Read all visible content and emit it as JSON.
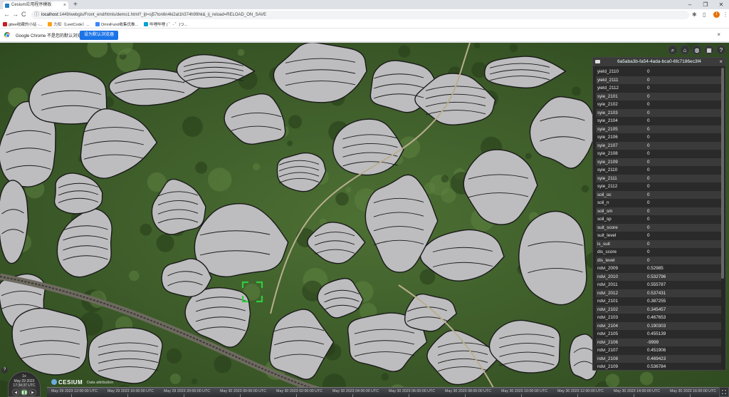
{
  "browser": {
    "tab_title": "Cesium应用程序模板",
    "tab_close": "×",
    "new_tab": "+",
    "window_controls": [
      "–",
      "❐",
      "✕"
    ],
    "url_host": "localhost",
    "url_rest": ":1449/webgis/Front_end/htmls/demo1.html?_ijt=sj57ton6n4ki2at1h374h99hk&_ij_reload=RELOAD_ON_SAVE",
    "nav": [
      "←",
      "→",
      "C",
      "⌂"
    ],
    "bookmarks": [
      {
        "label": "gitee收藏的小站 -...",
        "color": "#c71d23"
      },
      {
        "label": "力扣（LeetCode）...",
        "color": "#ffa116"
      },
      {
        "label": "OmniFund收集优推...",
        "color": "#3a86ff"
      },
      {
        "label": "哔哩哔哩 ( ゜- ゜)つ...",
        "color": "#00a1d6"
      }
    ],
    "infobar_text": "Google Chrome 不是您的默认浏览器",
    "infobar_button": "设为默认浏览器",
    "infobar_close": "×",
    "avatar_letter": "I"
  },
  "cesium_toolbar": [
    {
      "name": "search-icon",
      "glyph": "⌕"
    },
    {
      "name": "home-icon",
      "glyph": "⌂"
    },
    {
      "name": "globe-icon",
      "glyph": "◍"
    },
    {
      "name": "layers-icon",
      "glyph": "▦"
    },
    {
      "name": "help-icon",
      "glyph": "?"
    }
  ],
  "infobox": {
    "title": "6a5aba3b-fa54-4ada-bca0-6fc7186ec3f4",
    "close": "×",
    "rows": [
      {
        "key": "yield_2110",
        "value": "0"
      },
      {
        "key": "yield_2111",
        "value": "0"
      },
      {
        "key": "yield_2112",
        "value": "0"
      },
      {
        "key": "syie_2101",
        "value": "0"
      },
      {
        "key": "syie_2102",
        "value": "0"
      },
      {
        "key": "syie_2103",
        "value": "0"
      },
      {
        "key": "syie_2104",
        "value": "0"
      },
      {
        "key": "syie_2105",
        "value": "0"
      },
      {
        "key": "syie_2106",
        "value": "0"
      },
      {
        "key": "syie_2107",
        "value": "0"
      },
      {
        "key": "syie_2108",
        "value": "0"
      },
      {
        "key": "syie_2109",
        "value": "0"
      },
      {
        "key": "syie_2110",
        "value": "0"
      },
      {
        "key": "syie_2111",
        "value": "0"
      },
      {
        "key": "syie_2112",
        "value": "0"
      },
      {
        "key": "soil_oc",
        "value": "0"
      },
      {
        "key": "soil_n",
        "value": "0"
      },
      {
        "key": "soil_sm",
        "value": "0"
      },
      {
        "key": "soil_sp",
        "value": "0"
      },
      {
        "key": "suit_score",
        "value": "0"
      },
      {
        "key": "suit_level",
        "value": "0"
      },
      {
        "key": "is_suit",
        "value": "0"
      },
      {
        "key": "dis_score",
        "value": "0"
      },
      {
        "key": "dis_level",
        "value": "0"
      },
      {
        "key": "ndvi_2009",
        "value": "0.52985"
      },
      {
        "key": "ndvi_2010",
        "value": "0.532796"
      },
      {
        "key": "ndvi_2011",
        "value": "0.555787"
      },
      {
        "key": "ndvi_2012",
        "value": "0.537431"
      },
      {
        "key": "ndvi_2101",
        "value": "0.387255"
      },
      {
        "key": "ndvi_2102",
        "value": "0.345457"
      },
      {
        "key": "ndvi_2103",
        "value": "0.467653"
      },
      {
        "key": "ndvi_2104",
        "value": "0.190303"
      },
      {
        "key": "ndvi_2105",
        "value": "0.455139"
      },
      {
        "key": "ndvi_2106",
        "value": "-9999"
      },
      {
        "key": "ndvi_2107",
        "value": "0.451906"
      },
      {
        "key": "ndvi_2108",
        "value": "0.469423"
      },
      {
        "key": "ndvi_2109",
        "value": "0.536784"
      },
      {
        "key": "ndvi_2110",
        "value": "0.50403"
      }
    ]
  },
  "animation": {
    "speed": "1x",
    "date": "May 29 2023",
    "time": "17:34:37 UTC",
    "buttons": [
      "◀",
      "❚❚",
      "▶"
    ]
  },
  "credits": {
    "logo_text": "CESIUM",
    "text": "Data attribution"
  },
  "timeline": {
    "labels": [
      "May 29 2023 12:00:00 UTC",
      "May 29 2023 16:00:00 UTC",
      "May 29 2023 20:00:00 UTC",
      "May 30 2023 00:00:00 UTC",
      "May 30 2023 02:00:00 UTC",
      "May 30 2023 04:00:00 UTC",
      "May 30 2023 06:00:00 UTC",
      "May 30 2023 08:00:00 UTC",
      "May 30 2023 10:00:00 UTC",
      "May 30 2023 12:00:00 UTC",
      "May 30 2023 14:00:00 UTC",
      "May 30 2023 16:00:00 UTC"
    ]
  },
  "help_glyph": "?",
  "fullscreen_glyph": "⛶",
  "colors": {
    "parcel_fill": "#bdbdbf",
    "parcel_stroke": "#1a1a1a",
    "vegetation": "#41602c",
    "selection": "#2ecc40",
    "accent": "#1a73e8"
  }
}
